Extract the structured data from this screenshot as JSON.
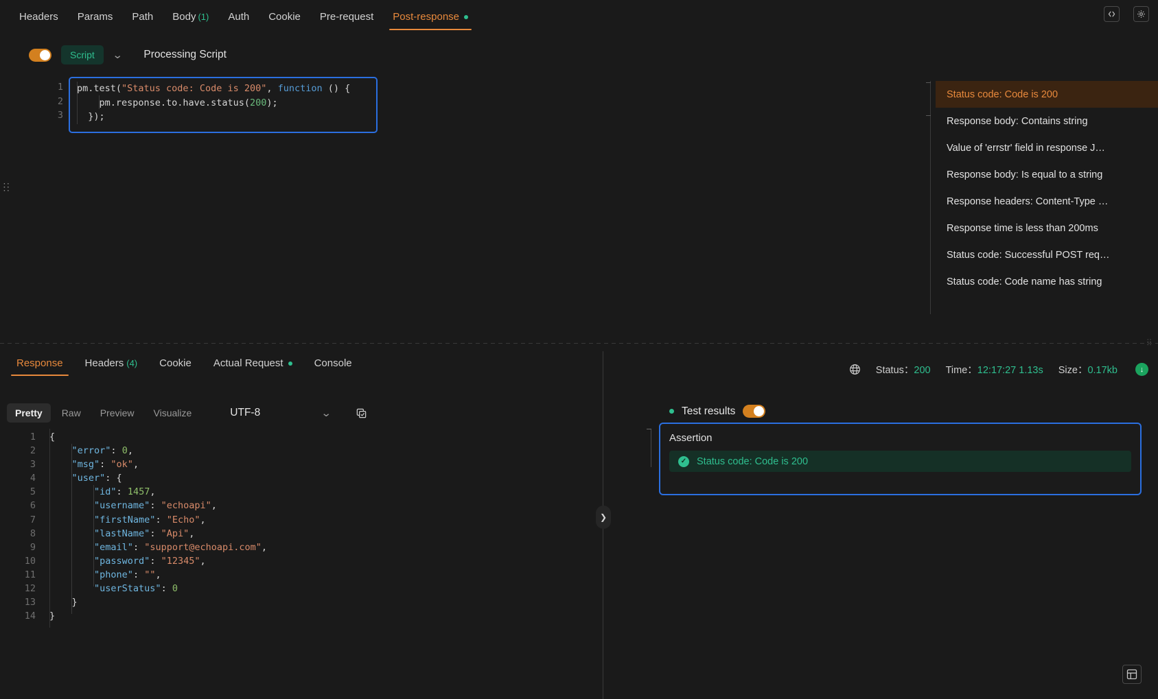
{
  "request_tabs": [
    {
      "label": "Headers",
      "count": null,
      "active": false,
      "dot": false
    },
    {
      "label": "Params",
      "count": null,
      "active": false,
      "dot": false
    },
    {
      "label": "Path",
      "count": null,
      "active": false,
      "dot": false
    },
    {
      "label": "Body",
      "count": "(1)",
      "active": false,
      "dot": false
    },
    {
      "label": "Auth",
      "count": null,
      "active": false,
      "dot": false
    },
    {
      "label": "Cookie",
      "count": null,
      "active": false,
      "dot": false
    },
    {
      "label": "Pre-request",
      "count": null,
      "active": false,
      "dot": false
    },
    {
      "label": "Post-response",
      "count": null,
      "active": true,
      "dot": true
    }
  ],
  "toolbar_icons": {
    "code": "code-icon",
    "settings": "gear-icon"
  },
  "script": {
    "enabled": true,
    "type_label": "Script",
    "title": "Processing Script",
    "line_numbers": [
      "1",
      "2",
      "3"
    ],
    "code": [
      "pm.test(\"Status code: Code is 200\", function () {",
      "    pm.response.to.have.status(200);",
      "  });"
    ]
  },
  "snippets": [
    {
      "label": "Status code: Code is 200",
      "selected": true
    },
    {
      "label": "Response body: Contains string",
      "selected": false
    },
    {
      "label": "Value of 'errstr' field in response J…",
      "selected": false
    },
    {
      "label": "Response body: Is equal to a string",
      "selected": false
    },
    {
      "label": "Response headers: Content-Type …",
      "selected": false
    },
    {
      "label": "Response time is less than 200ms",
      "selected": false
    },
    {
      "label": "Status code: Successful POST req…",
      "selected": false
    },
    {
      "label": "Status code: Code name has string",
      "selected": false
    }
  ],
  "response_tabs": [
    {
      "label": "Response",
      "count": null,
      "active": true,
      "dot": false
    },
    {
      "label": "Headers",
      "count": "(4)",
      "active": false,
      "dot": false
    },
    {
      "label": "Cookie",
      "count": null,
      "active": false,
      "dot": false
    },
    {
      "label": "Actual Request",
      "count": null,
      "active": false,
      "dot": true
    },
    {
      "label": "Console",
      "count": null,
      "active": false,
      "dot": false
    }
  ],
  "status": {
    "globe_icon": "globe-icon",
    "status_label": "Status：",
    "status_value": "200",
    "time_label": "Time：",
    "time_value": "12:17:27 1.13s",
    "size_label": "Size：",
    "size_value": "0.17kb",
    "download_icon": "download-icon"
  },
  "format_bar": {
    "modes": [
      {
        "label": "Pretty",
        "active": true
      },
      {
        "label": "Raw",
        "active": false
      },
      {
        "label": "Preview",
        "active": false
      },
      {
        "label": "Visualize",
        "active": false
      }
    ],
    "encoding": "UTF-8",
    "chevron_icon": "chevron-down-icon",
    "copy_icon": "copy-icon"
  },
  "response_body": {
    "line_numbers": [
      "1",
      "2",
      "3",
      "4",
      "5",
      "6",
      "7",
      "8",
      "9",
      "10",
      "11",
      "12",
      "13",
      "14"
    ],
    "lines": [
      [
        {
          "t": "{",
          "c": "pun"
        }
      ],
      [
        {
          "t": "    ",
          "c": "pun"
        },
        {
          "t": "\"error\"",
          "c": "key"
        },
        {
          "t": ": ",
          "c": "pun"
        },
        {
          "t": "0",
          "c": "num"
        },
        {
          "t": ",",
          "c": "pun"
        }
      ],
      [
        {
          "t": "    ",
          "c": "pun"
        },
        {
          "t": "\"msg\"",
          "c": "key"
        },
        {
          "t": ": ",
          "c": "pun"
        },
        {
          "t": "\"ok\"",
          "c": "str"
        },
        {
          "t": ",",
          "c": "pun"
        }
      ],
      [
        {
          "t": "    ",
          "c": "pun"
        },
        {
          "t": "\"user\"",
          "c": "key"
        },
        {
          "t": ": {",
          "c": "pun"
        }
      ],
      [
        {
          "t": "        ",
          "c": "pun"
        },
        {
          "t": "\"id\"",
          "c": "key"
        },
        {
          "t": ": ",
          "c": "pun"
        },
        {
          "t": "1457",
          "c": "num"
        },
        {
          "t": ",",
          "c": "pun"
        }
      ],
      [
        {
          "t": "        ",
          "c": "pun"
        },
        {
          "t": "\"username\"",
          "c": "key"
        },
        {
          "t": ": ",
          "c": "pun"
        },
        {
          "t": "\"echoapi\"",
          "c": "str"
        },
        {
          "t": ",",
          "c": "pun"
        }
      ],
      [
        {
          "t": "        ",
          "c": "pun"
        },
        {
          "t": "\"firstName\"",
          "c": "key"
        },
        {
          "t": ": ",
          "c": "pun"
        },
        {
          "t": "\"Echo\"",
          "c": "str"
        },
        {
          "t": ",",
          "c": "pun"
        }
      ],
      [
        {
          "t": "        ",
          "c": "pun"
        },
        {
          "t": "\"lastName\"",
          "c": "key"
        },
        {
          "t": ": ",
          "c": "pun"
        },
        {
          "t": "\"Api\"",
          "c": "str"
        },
        {
          "t": ",",
          "c": "pun"
        }
      ],
      [
        {
          "t": "        ",
          "c": "pun"
        },
        {
          "t": "\"email\"",
          "c": "key"
        },
        {
          "t": ": ",
          "c": "pun"
        },
        {
          "t": "\"support@echoapi.com\"",
          "c": "str"
        },
        {
          "t": ",",
          "c": "pun"
        }
      ],
      [
        {
          "t": "        ",
          "c": "pun"
        },
        {
          "t": "\"password\"",
          "c": "key"
        },
        {
          "t": ": ",
          "c": "pun"
        },
        {
          "t": "\"12345\"",
          "c": "str"
        },
        {
          "t": ",",
          "c": "pun"
        }
      ],
      [
        {
          "t": "        ",
          "c": "pun"
        },
        {
          "t": "\"phone\"",
          "c": "key"
        },
        {
          "t": ": ",
          "c": "pun"
        },
        {
          "t": "\"\"",
          "c": "str"
        },
        {
          "t": ",",
          "c": "pun"
        }
      ],
      [
        {
          "t": "        ",
          "c": "pun"
        },
        {
          "t": "\"userStatus\"",
          "c": "key"
        },
        {
          "t": ": ",
          "c": "pun"
        },
        {
          "t": "0",
          "c": "num"
        }
      ],
      [
        {
          "t": "    }",
          "c": "pun"
        }
      ],
      [
        {
          "t": "}",
          "c": "pun"
        }
      ]
    ]
  },
  "test_results": {
    "label": "Test results",
    "enabled": true,
    "panel_title": "Assertion",
    "assertions": [
      {
        "label": "Status code: Code is 200",
        "passed": true,
        "icon": "check-circle-icon"
      }
    ]
  },
  "collapse_icon": "chevron-right-icon",
  "grid_icon": "grid-layout-icon",
  "colors": {
    "accent": "#e8893c",
    "success": "#2fbf8f",
    "focus_border": "#2b6fe0",
    "background": "#1a1a1a"
  }
}
